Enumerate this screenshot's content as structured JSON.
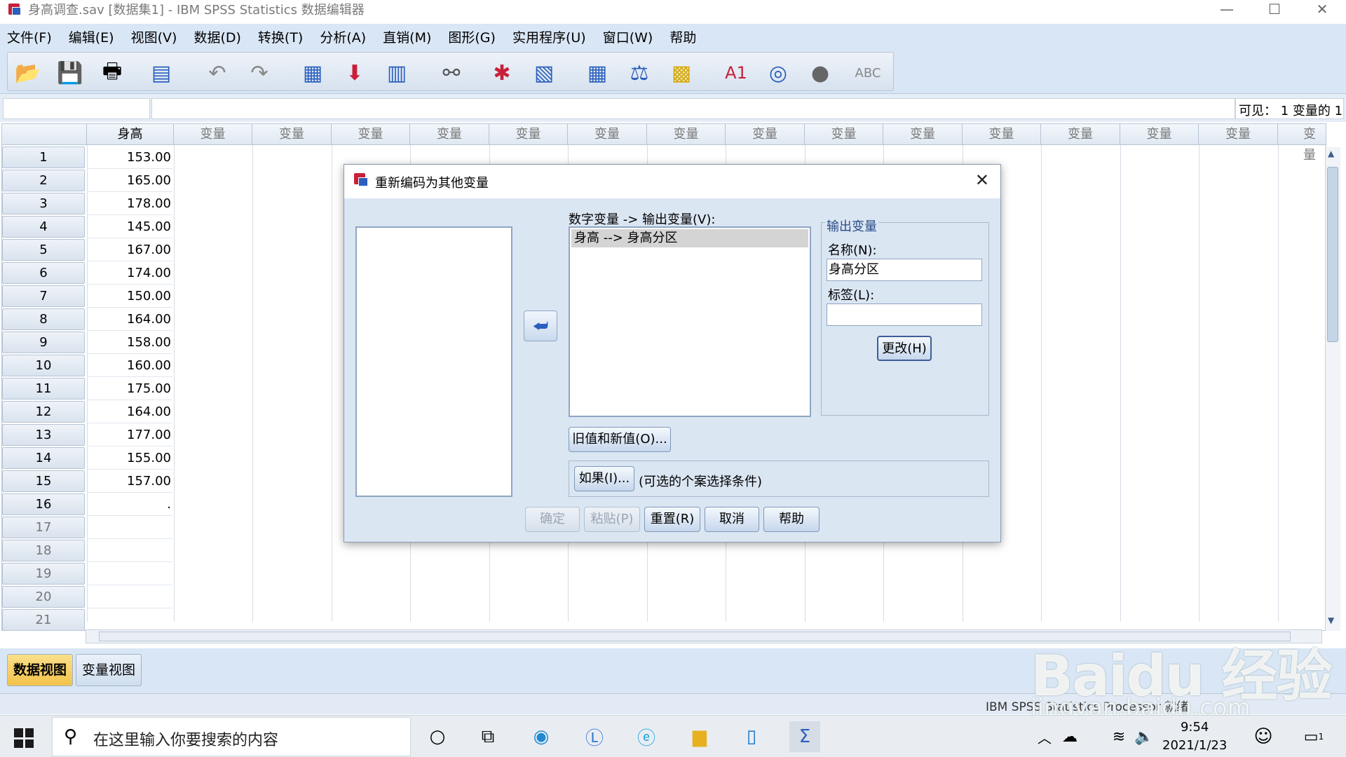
{
  "window": {
    "title": "身高调查.sav [数据集1] - IBM SPSS Statistics 数据编辑器",
    "controls": [
      "—",
      "☐",
      "✕"
    ]
  },
  "menu": [
    "文件(F)",
    "编辑(E)",
    "视图(V)",
    "数据(D)",
    "转换(T)",
    "分析(A)",
    "直销(M)",
    "图形(G)",
    "实用程序(U)",
    "窗口(W)",
    "帮助"
  ],
  "toolbar": {
    "icons": [
      "open-folder-icon",
      "save-icon",
      "print-icon",
      "dialog-recall-icon",
      "undo-icon",
      "redo-icon",
      "goto-case-icon",
      "goto-variable-icon",
      "variables-icon",
      "find-icon",
      "insert-cases-icon",
      "insert-variable-icon",
      "split-file-icon",
      "weight-cases-icon",
      "select-cases-icon",
      "value-labels-icon",
      "use-sets-icon",
      "show-all-variables-icon",
      "spelling-icon"
    ]
  },
  "editbar": {
    "visible": "可见： 1 变量的 1"
  },
  "grid": {
    "columns": [
      "身高",
      "变量",
      "变量",
      "变量",
      "变量",
      "变量",
      "变量",
      "变量",
      "变量",
      "变量",
      "变量",
      "变量",
      "变量",
      "变量",
      "变量",
      "变量"
    ],
    "rows": [
      "1",
      "2",
      "3",
      "4",
      "5",
      "6",
      "7",
      "8",
      "9",
      "10",
      "11",
      "12",
      "13",
      "14",
      "15",
      "16",
      "17",
      "18",
      "19",
      "20",
      "21"
    ],
    "values": [
      "153.00",
      "165.00",
      "178.00",
      "145.00",
      "167.00",
      "174.00",
      "150.00",
      "164.00",
      "158.00",
      "160.00",
      "175.00",
      "164.00",
      "177.00",
      "155.00",
      "157.00",
      "."
    ]
  },
  "dialog": {
    "title": "重新编码为其他变量",
    "mapping_label": "数字变量 -> 输出变量(V):",
    "mapping_item": "身高 --> 身高分区",
    "output_group": "输出变量",
    "name_label": "名称(N):",
    "name_value": "身高分区",
    "label_label": "标签(L):",
    "label_value": "",
    "change_button": "更改(H)",
    "old_new_button": "旧值和新值(O)...",
    "if_button": "如果(I)...",
    "if_hint": "(可选的个案选择条件)",
    "ok": "确定",
    "paste": "粘贴(P)",
    "reset": "重置(R)",
    "cancel": "取消",
    "help": "帮助"
  },
  "tabs": {
    "data_view": "数据视图",
    "variable_view": "变量视图"
  },
  "status": {
    "text": "IBM SPSS Statistics Processor 就绪"
  },
  "taskbar": {
    "search_placeholder": "在这里输入你要搜索的内容",
    "time": "9:54",
    "date": "2021/1/23",
    "notification_count": "1"
  },
  "watermark": {
    "brand": "Bai",
    "brand_suffix": "du 经验",
    "url": "jingyan.baidu.com"
  }
}
